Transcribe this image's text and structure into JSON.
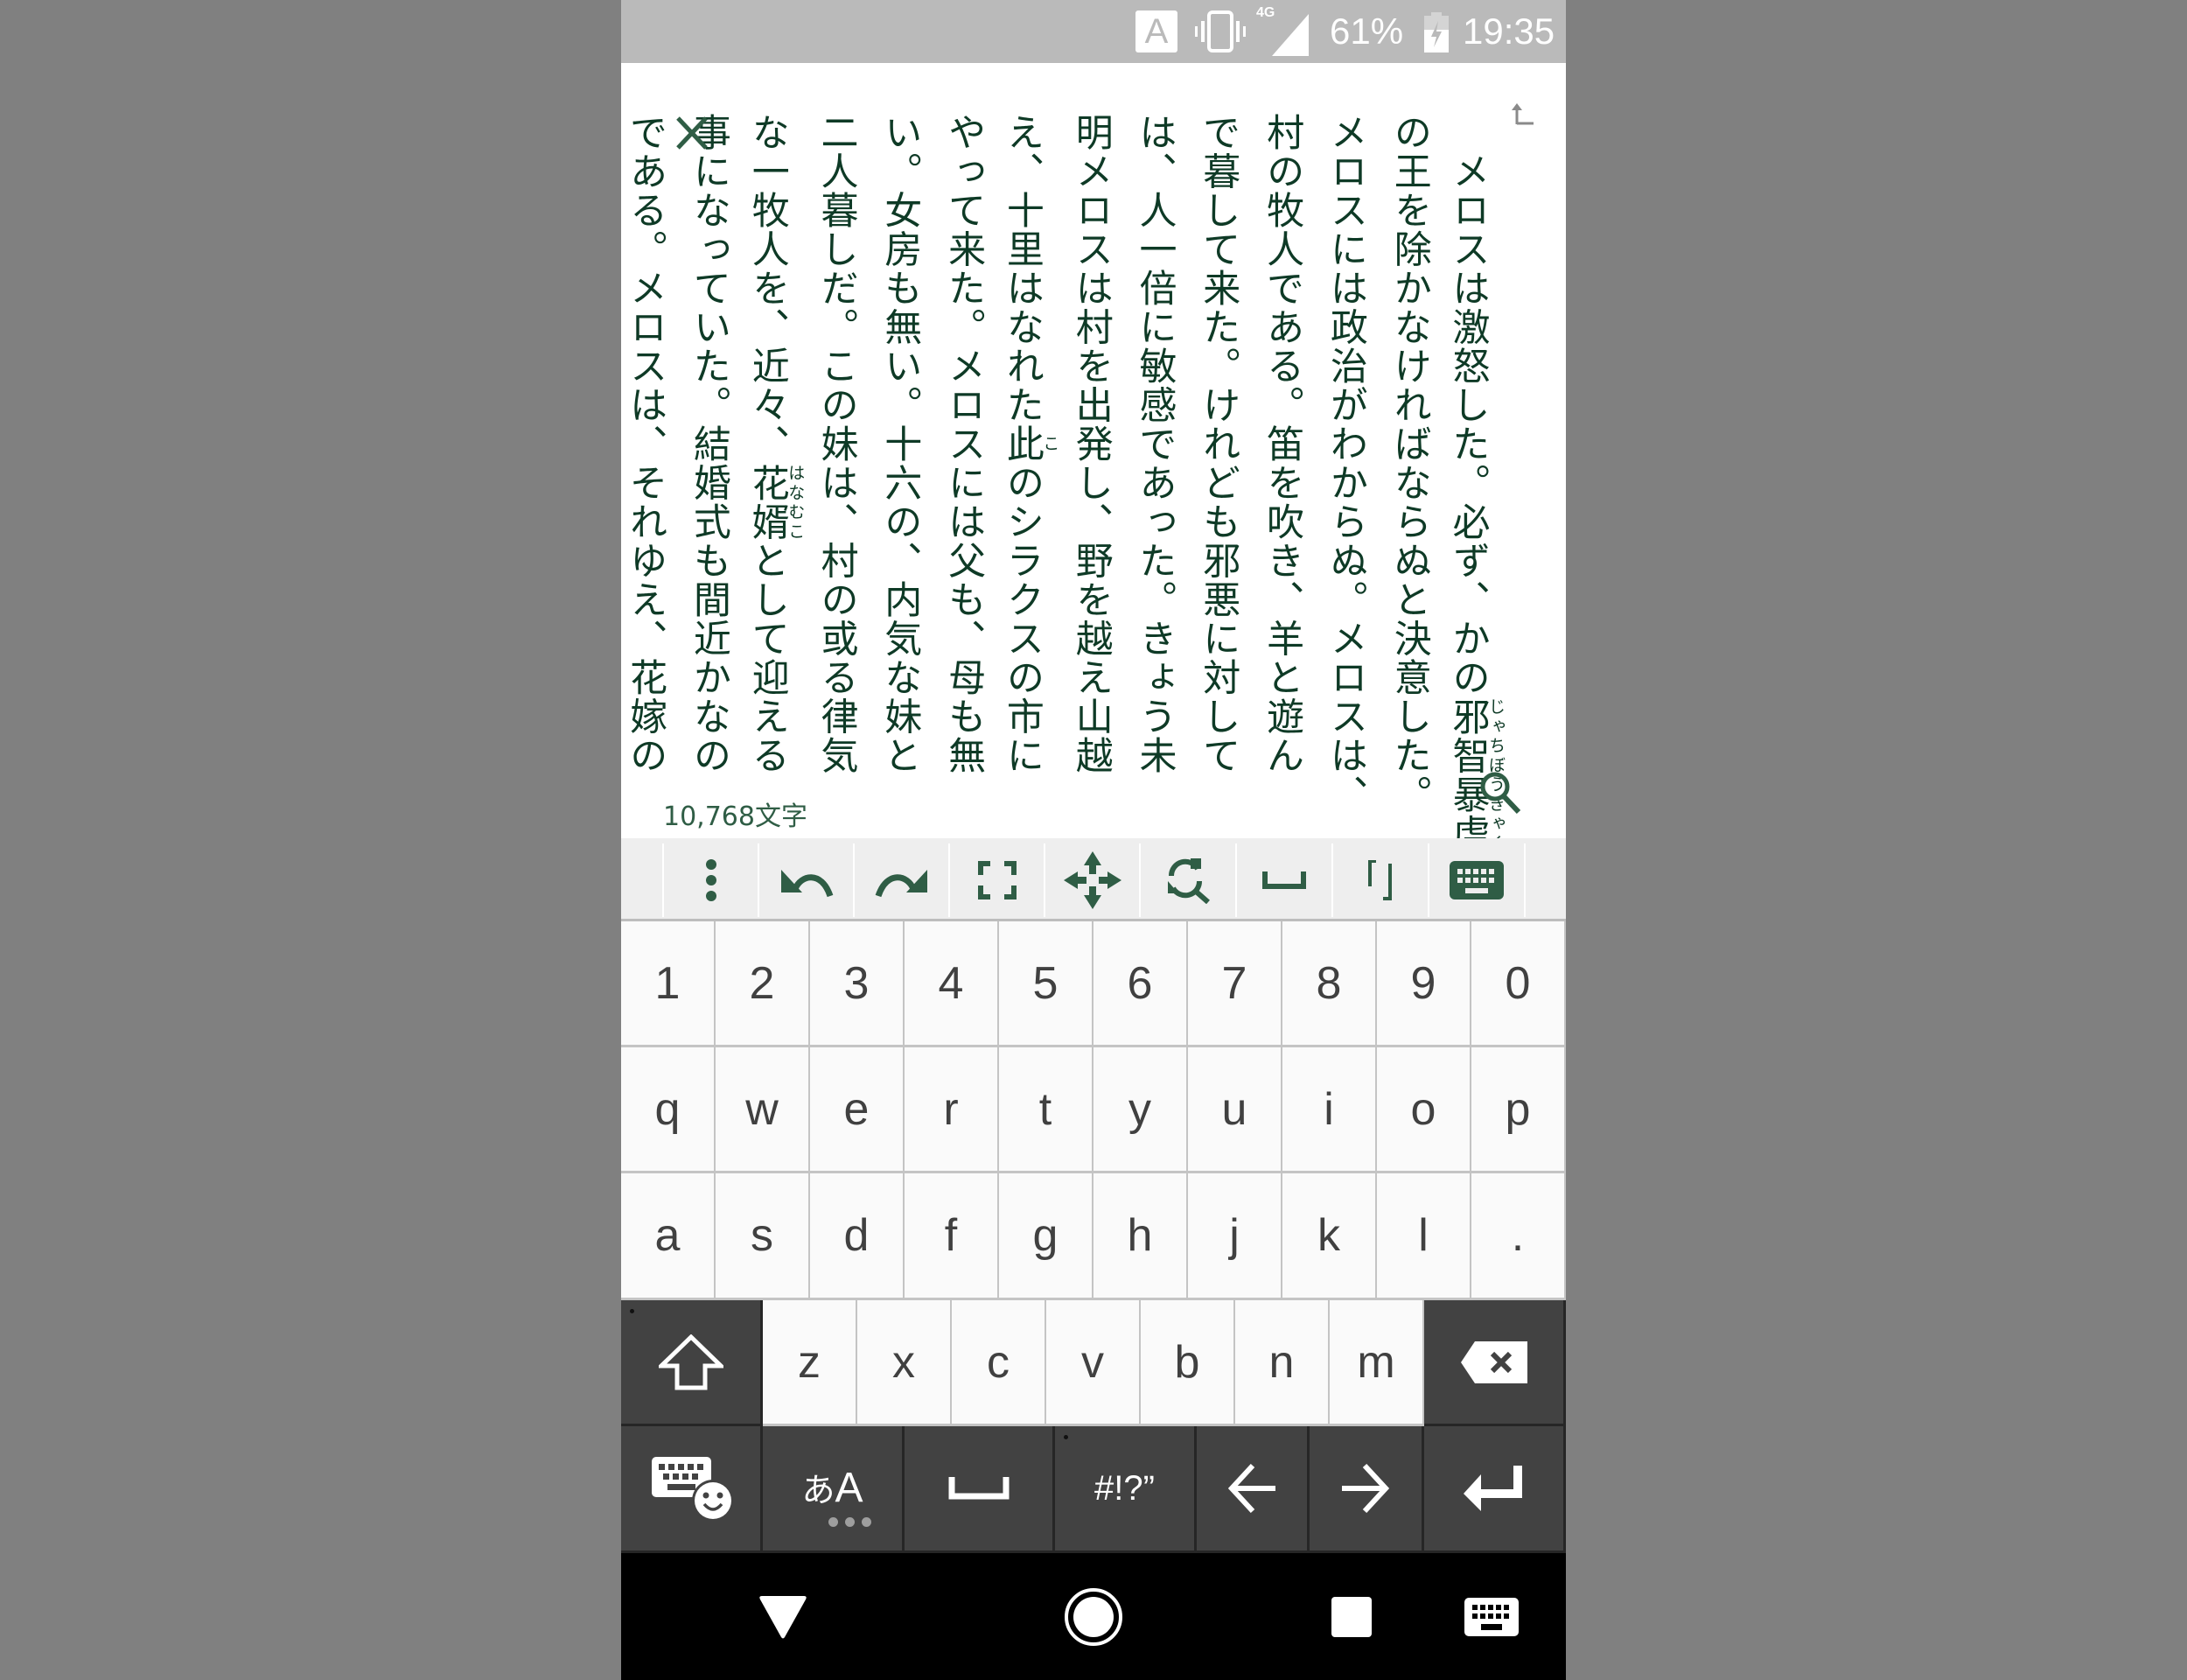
{
  "status_bar": {
    "input_indicator": "A",
    "vibrate_icon": "vibrate-icon",
    "network_type": "4G",
    "signal_icon": "signal-icon",
    "battery_percent": "61%",
    "battery_icon": "battery-charging-icon",
    "time": "19:35"
  },
  "editor": {
    "columns": [
      {
        "pre": "　メロスは激怒した。必ず、かの",
        "ruby_base": "邪智暴虐",
        "ruby_text": "じゃちぼうぎゃく",
        "post": ""
      },
      {
        "pre": "の王を除かなければならぬと決意した。",
        "ruby_base": "",
        "ruby_text": "",
        "post": ""
      },
      {
        "pre": "メロスには政治がわからぬ。メロスは、",
        "ruby_base": "",
        "ruby_text": "",
        "post": ""
      },
      {
        "pre": "村の牧人である。笛を吹き、羊と遊ん",
        "ruby_base": "",
        "ruby_text": "",
        "post": ""
      },
      {
        "pre": "で暮して来た。けれども邪悪に対して",
        "ruby_base": "",
        "ruby_text": "",
        "post": ""
      },
      {
        "pre": "は、人一倍に敏感であった。きょう未",
        "ruby_base": "",
        "ruby_text": "",
        "post": ""
      },
      {
        "pre": "明メロスは村を出発し、野を越え山越",
        "ruby_base": "",
        "ruby_text": "",
        "post": ""
      },
      {
        "pre": "え、十里はなれた",
        "ruby_base": "此",
        "ruby_text": "こ",
        "post": "のシラクスの市に"
      },
      {
        "pre": "やって来た。メロスには父も、母も無",
        "ruby_base": "",
        "ruby_text": "",
        "post": ""
      },
      {
        "pre": "い。女房も無い。十六の、内気な妹と",
        "ruby_base": "",
        "ruby_text": "",
        "post": ""
      },
      {
        "pre": "二人暮しだ。この妹は、村の或る律気",
        "ruby_base": "",
        "ruby_text": "",
        "post": ""
      },
      {
        "pre": "な一牧人を、近々、",
        "ruby_base": "花婿",
        "ruby_text": "はなむこ",
        "post": "として迎える"
      },
      {
        "pre": "事になっていた。結婚式も間近かなの",
        "ruby_base": "",
        "ruby_text": "",
        "post": ""
      },
      {
        "pre": "である。メロスは、それゆえ、花嫁の",
        "ruby_base": "",
        "ruby_text": "",
        "post": ""
      }
    ],
    "char_count": "10,768文字"
  },
  "toolbar": {
    "items": [
      {
        "name": "menu",
        "icon": "more-vert-icon"
      },
      {
        "name": "undo",
        "icon": "undo-icon"
      },
      {
        "name": "redo",
        "icon": "redo-icon"
      },
      {
        "name": "fullscreen",
        "icon": "fullscreen-icon"
      },
      {
        "name": "move-cursor",
        "icon": "move-arrows-icon"
      },
      {
        "name": "search-replace",
        "icon": "search-replace-icon"
      },
      {
        "name": "insert-space",
        "icon": "space-icon"
      },
      {
        "name": "insert-brackets",
        "icon": "brackets-icon",
        "label": "「」"
      },
      {
        "name": "toggle-keyboard",
        "icon": "keyboard-icon"
      }
    ]
  },
  "keyboard": {
    "row_numbers": [
      "1",
      "2",
      "3",
      "4",
      "5",
      "6",
      "7",
      "8",
      "9",
      "0"
    ],
    "row_top": [
      "q",
      "w",
      "e",
      "r",
      "t",
      "y",
      "u",
      "i",
      "o",
      "p"
    ],
    "row_middle": [
      "a",
      "s",
      "d",
      "f",
      "g",
      "h",
      "j",
      "k",
      "l",
      "."
    ],
    "row_bottom": [
      "z",
      "x",
      "c",
      "v",
      "b",
      "n",
      "m"
    ],
    "shift_icon": "shift-icon",
    "backspace_icon": "backspace-icon",
    "emoji_keyboard_icon": "keyboard-emoji-icon",
    "lang_switch": {
      "kana": "あ",
      "latin": "A"
    },
    "space_icon": "space-bar-icon",
    "symbols_label": "#!?”",
    "left_arrow_icon": "arrow-left-icon",
    "right_arrow_icon": "arrow-right-icon",
    "enter_icon": "enter-icon"
  },
  "nav_bar": {
    "back_icon": "back-triangle-icon",
    "home_icon": "home-circle-icon",
    "recents_icon": "recents-square-icon",
    "ime_switch_icon": "keyboard-switch-icon"
  },
  "colors": {
    "text": "#0e3a26",
    "accent": "#2f5d45",
    "status_bar": "#bababa",
    "toolbar_bg": "#eeeeee",
    "key_light": "#fafafa",
    "key_dark": "#424242"
  }
}
